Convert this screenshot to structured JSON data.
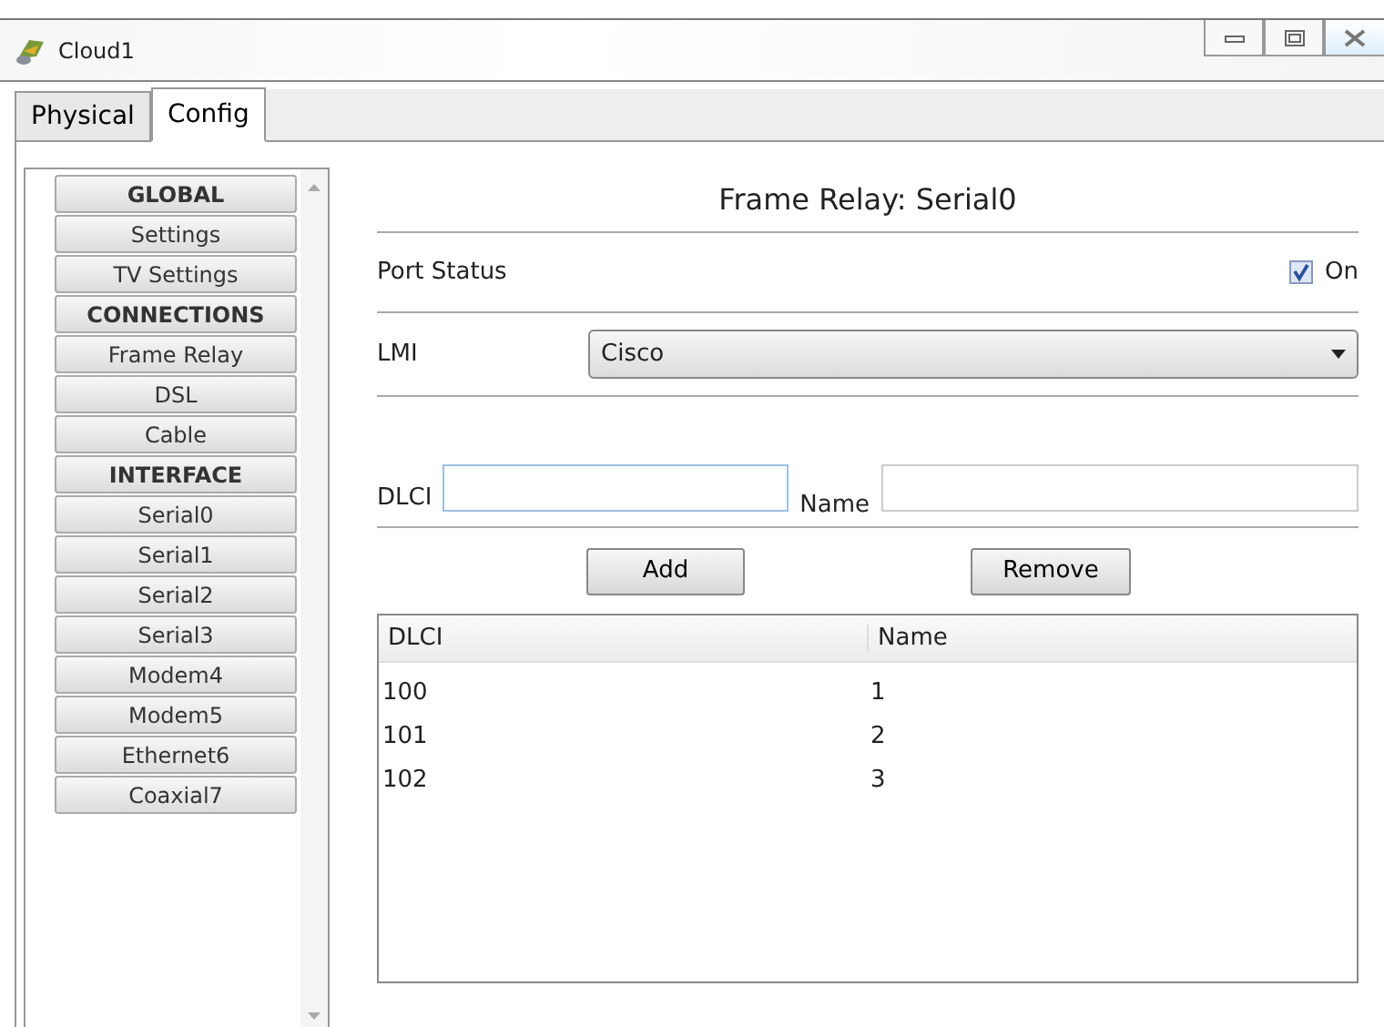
{
  "window": {
    "title": "Cloud1"
  },
  "tabs": [
    {
      "label": "Physical",
      "selected": false
    },
    {
      "label": "Config",
      "selected": true
    }
  ],
  "sidebar": {
    "items": [
      {
        "kind": "header",
        "label": "GLOBAL"
      },
      {
        "kind": "button",
        "label": "Settings"
      },
      {
        "kind": "button",
        "label": "TV Settings"
      },
      {
        "kind": "header",
        "label": "CONNECTIONS"
      },
      {
        "kind": "button",
        "label": "Frame Relay"
      },
      {
        "kind": "button",
        "label": "DSL"
      },
      {
        "kind": "button",
        "label": "Cable"
      },
      {
        "kind": "header",
        "label": "INTERFACE"
      },
      {
        "kind": "button",
        "label": "Serial0"
      },
      {
        "kind": "button",
        "label": "Serial1"
      },
      {
        "kind": "button",
        "label": "Serial2"
      },
      {
        "kind": "button",
        "label": "Serial3"
      },
      {
        "kind": "button",
        "label": "Modem4"
      },
      {
        "kind": "button",
        "label": "Modem5"
      },
      {
        "kind": "button",
        "label": "Ethernet6"
      },
      {
        "kind": "button",
        "label": "Coaxial7"
      }
    ]
  },
  "panel": {
    "title": "Frame Relay: Serial0",
    "port_status": {
      "label": "Port Status",
      "checked": true,
      "option": "On"
    },
    "lmi": {
      "label": "LMI",
      "value": "Cisco"
    },
    "dlci_field": {
      "label": "DLCI"
    },
    "name_field": {
      "label": "Name"
    },
    "buttons": [
      "Add",
      "Remove"
    ],
    "table": {
      "columns": [
        "DLCI",
        "Name"
      ],
      "rows": [
        [
          "100",
          "1"
        ],
        [
          "101",
          "2"
        ],
        [
          "102",
          "3"
        ]
      ]
    }
  }
}
